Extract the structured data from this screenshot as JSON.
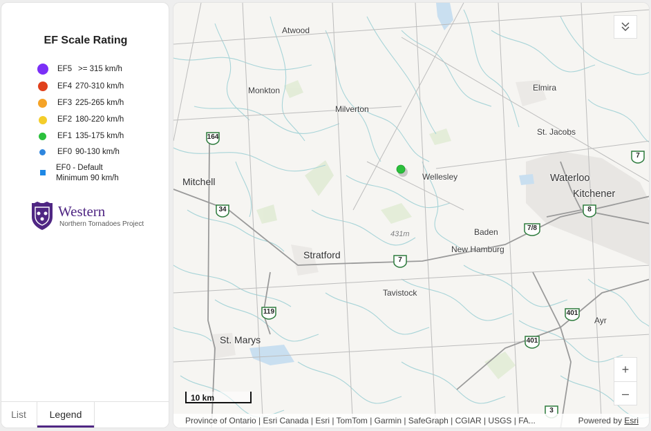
{
  "legend": {
    "title": "EF Scale Rating",
    "items": [
      {
        "code": "EF5",
        "range": ">= 315 km/h",
        "color": "#7b2ff7"
      },
      {
        "code": "EF4",
        "range": "270-310 km/h",
        "color": "#e0401c"
      },
      {
        "code": "EF3",
        "range": "225-265 km/h",
        "color": "#f5a327"
      },
      {
        "code": "EF2",
        "range": "180-220 km/h",
        "color": "#f4cd2a"
      },
      {
        "code": "EF1",
        "range": "135-175 km/h",
        "color": "#2bc03c"
      },
      {
        "code": "EF0",
        "range": "90-130 km/h",
        "color": "#2e86de"
      }
    ],
    "default_line1": "EF0 - Default",
    "default_line2": "Minimum 90 km/h",
    "default_color": "#1e88e5"
  },
  "logo": {
    "name": "Western",
    "subtitle": "Northern Tornadoes Project",
    "color": "#4f2683"
  },
  "tabs": {
    "list": "List",
    "legend": "Legend",
    "active": "Legend"
  },
  "map": {
    "places": {
      "atwood": "Atwood",
      "monkton": "Monkton",
      "milverton": "Milverton",
      "elmira": "Elmira",
      "stjacobs": "St. Jacobs",
      "wellesley": "Wellesley",
      "waterloo": "Waterloo",
      "kitchener": "Kitchener",
      "mitchell": "Mitchell",
      "baden": "Baden",
      "newhamburg": "New Hamburg",
      "stratford": "Stratford",
      "tavistock": "Tavistock",
      "stmarys": "St. Marys",
      "ayr": "Ayr",
      "elev": "431m"
    },
    "highways": {
      "h164": "164",
      "h34": "34",
      "h7a": "7",
      "h7b": "7",
      "h8": "8",
      "h78": "7/8",
      "h119": "119",
      "h401a": "401",
      "h401b": "401",
      "h3": "3"
    },
    "marker": {
      "rating": "EF1",
      "color": "#2bc03c"
    },
    "scale": "10 km",
    "zoom_in": "+",
    "zoom_out": "–",
    "attribution": "Province of Ontario | Esri Canada | Esri | TomTom | Garmin | SafeGraph | CGIAR | USGS | FA...",
    "powered_by": "Powered by",
    "esri": "Esri"
  }
}
